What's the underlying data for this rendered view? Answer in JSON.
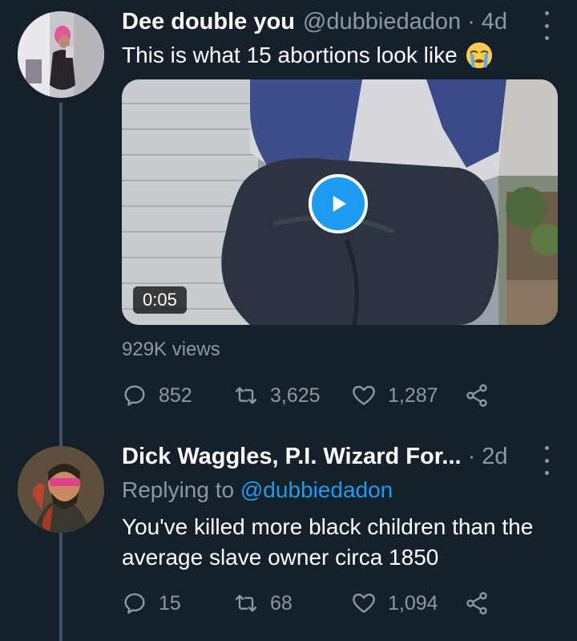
{
  "tweet": {
    "display_name": "Dee double you",
    "handle": "@dubbiedadon",
    "separator": "·",
    "time": "4d",
    "text": "This is what 15 abortions look like",
    "emoji": "loudly-crying-face-emoji",
    "video": {
      "duration": "0:05",
      "play_icon": "play-icon"
    },
    "views": "929K views",
    "actions": {
      "reply_count": "852",
      "retweet_count": "3,625",
      "like_count": "1,287"
    }
  },
  "reply": {
    "display_name": "Dick Waggles, P.I. Wizard For...",
    "separator": "·",
    "time": "2d",
    "replying_prefix": "Replying to",
    "replying_handle": "@dubbiedadon",
    "text": "You've killed more black children than the average slave owner circa 1850",
    "actions": {
      "reply_count": "15",
      "retweet_count": "68",
      "like_count": "1,094"
    }
  },
  "colors": {
    "background": "#15202b",
    "secondary_text": "#8b98a5",
    "accent": "#1d9bf0",
    "thread_line": "#3d5466"
  }
}
